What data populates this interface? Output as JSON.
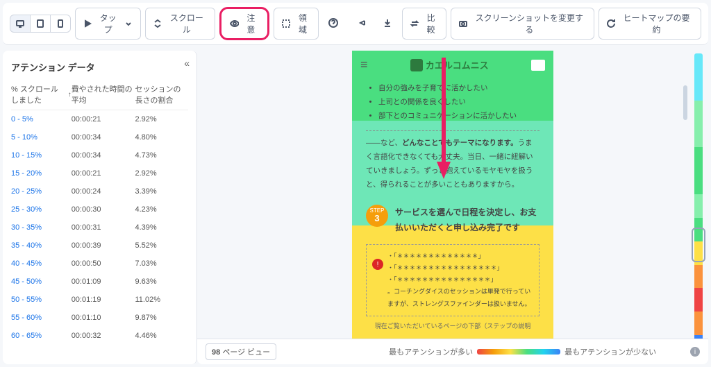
{
  "toolbar": {
    "device_group": [
      "desktop",
      "tablet",
      "mobile"
    ],
    "tap": "タップ",
    "scroll": "スクロール",
    "attention": "注意",
    "area": "領域",
    "compare": "比較",
    "change_screenshot": "スクリーンショットを変更する",
    "heatmap_summary": "ヒートマップの要約"
  },
  "sidebar": {
    "title": "アテンション データ",
    "columns": {
      "c1": "% スクロールしました",
      "c2": "費やされた時間の平均",
      "c3": "セッションの長さの割合"
    },
    "rows": [
      {
        "range": "0 - 5%",
        "time": "00:00:21",
        "pct": "2.92%"
      },
      {
        "range": "5 - 10%",
        "time": "00:00:34",
        "pct": "4.80%"
      },
      {
        "range": "10 - 15%",
        "time": "00:00:34",
        "pct": "4.73%"
      },
      {
        "range": "15 - 20%",
        "time": "00:00:21",
        "pct": "2.92%"
      },
      {
        "range": "20 - 25%",
        "time": "00:00:24",
        "pct": "3.39%"
      },
      {
        "range": "25 - 30%",
        "time": "00:00:30",
        "pct": "4.23%"
      },
      {
        "range": "30 - 35%",
        "time": "00:00:31",
        "pct": "4.39%"
      },
      {
        "range": "35 - 40%",
        "time": "00:00:39",
        "pct": "5.52%"
      },
      {
        "range": "40 - 45%",
        "time": "00:00:50",
        "pct": "7.03%"
      },
      {
        "range": "45 - 50%",
        "time": "00:01:09",
        "pct": "9.63%"
      },
      {
        "range": "50 - 55%",
        "time": "00:01:19",
        "pct": "11.02%"
      },
      {
        "range": "55 - 60%",
        "time": "00:01:10",
        "pct": "9.87%"
      },
      {
        "range": "60 - 65%",
        "time": "00:00:32",
        "pct": "4.46%"
      }
    ]
  },
  "preview": {
    "brand": "カエルコムニス",
    "bullets": [
      "自分の強みを子育てに活かしたい",
      "上司との関係を良くしたい",
      "部下とのコミュニケーションに活かしたい"
    ],
    "paragraph_lead": "――など、",
    "paragraph_bold": "どんなことでもテーマになります。",
    "paragraph_rest": "うまく言語化できなくても大丈夫。当日、一緒に紐解いていきましょう。ずっと抱えているモヤモヤを扱うと、得られることが多いこともありますから。",
    "step_label": "STEP",
    "step_num": "3",
    "step_text": "サービスを選んで日程を決定し、お支払いいただくと申し込み完了です",
    "note_dots1": "・「＊＊＊＊＊＊＊＊＊＊＊＊＊」",
    "note_dots2": "・「＊＊＊＊＊＊＊＊＊＊＊＊＊＊＊＊」",
    "note_dots3": "・「＊＊＊＊＊＊＊＊＊＊＊＊＊＊＊」",
    "note_text": "。コーチングダイスのセッションは単発で行っていますが、ストレングスファインダーは扱いません。",
    "footer": "現在ご覧いただいているページの下部（ステップの説明"
  },
  "bottom": {
    "pv_count": "98",
    "pv_label": "ページ ビュー",
    "legend_most": "最もアテンションが多い",
    "legend_least": "最もアテンションが少ない"
  },
  "minimap_colors": [
    "#67e8f9",
    "#67e8f9",
    "#86efac",
    "#86efac",
    "#4ade80",
    "#4ade80",
    "#86efac",
    "#4ade80",
    "#fde047",
    "#fb923c",
    "#ef4444",
    "#fb923c",
    "#3b82f6"
  ]
}
